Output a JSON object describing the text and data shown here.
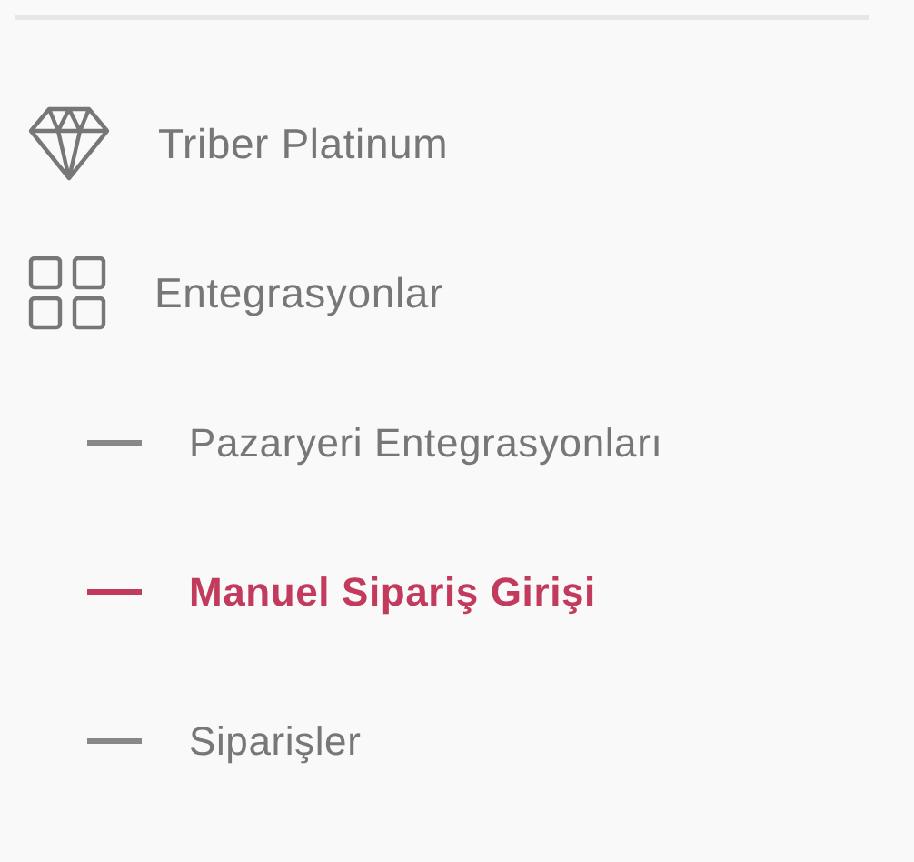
{
  "menu": [
    {
      "label": "Triber Platinum"
    },
    {
      "label": "Entegrasyonlar",
      "children": [
        {
          "label": "Pazaryeri Entegrasyonları",
          "selected": false
        },
        {
          "label": "Manuel Sipariş Girişi",
          "selected": true
        },
        {
          "label": "Siparişler",
          "selected": false
        }
      ]
    }
  ]
}
